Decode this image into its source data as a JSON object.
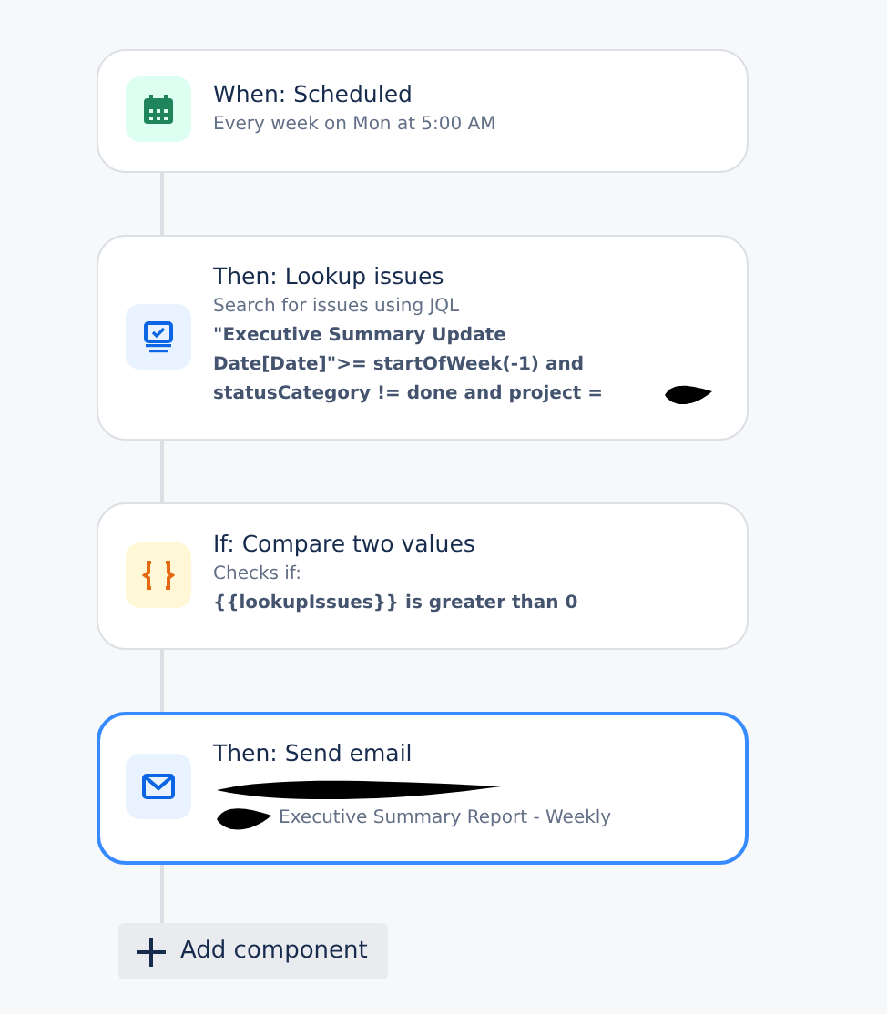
{
  "steps": [
    {
      "kind": "schedule",
      "title": "When: Scheduled",
      "description": "Every week on Mon at 5:00 AM",
      "selected": false,
      "redacted": false
    },
    {
      "kind": "lookup",
      "title": "Then: Lookup issues",
      "description": "Search for issues using JQL",
      "detail": "\"Executive Summary Update Date[Date]\">= startOfWeek(-1) and statusCategory != done and project =",
      "selected": false,
      "redacted": true
    },
    {
      "kind": "condition",
      "title": "If: Compare two values",
      "description": "Checks if:",
      "detail": "{{lookupIssues}} is greater than 0",
      "selected": false,
      "redacted": false
    },
    {
      "kind": "email",
      "title": "Then: Send email",
      "description": "Executive Summary Report - Weekly",
      "selected": true,
      "redacted": true
    }
  ],
  "add_button": {
    "label": "Add component"
  }
}
